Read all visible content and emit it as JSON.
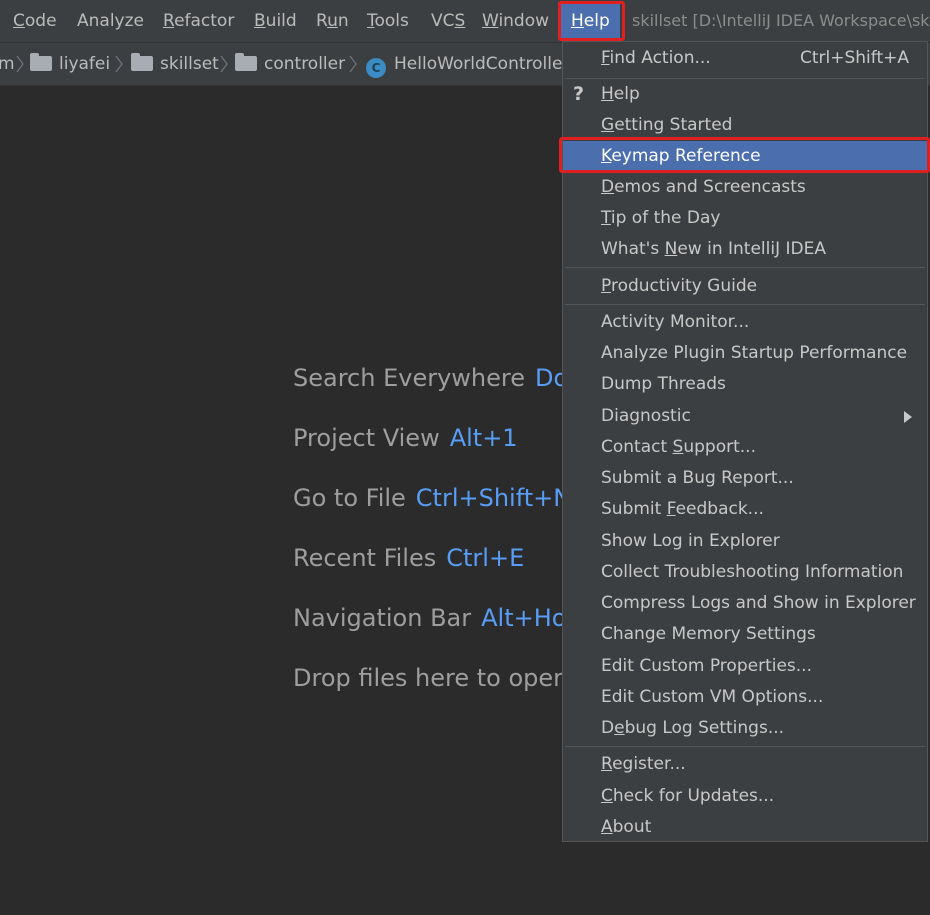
{
  "menubar": {
    "items": [
      {
        "label": "Code",
        "mn": 0
      },
      {
        "label": "Analyze",
        "mn": -1
      },
      {
        "label": "Refactor",
        "mn": 0
      },
      {
        "label": "Build",
        "mn": 0
      },
      {
        "label": "Run",
        "mn": 1
      },
      {
        "label": "Tools",
        "mn": 0
      },
      {
        "label": "VCS",
        "mn": 2
      },
      {
        "label": "Window",
        "mn": 0
      },
      {
        "label": "Help",
        "mn": 0
      }
    ],
    "window_title": "skillset [D:\\IntelliJ IDEA Workspace\\sk"
  },
  "breadcrumb": {
    "items": [
      "m",
      "liyafei",
      "skillset",
      "controller",
      "HelloWorldControlle"
    ],
    "class_icon_letter": "C"
  },
  "hints": [
    {
      "label": "Search Everywhere",
      "key": "Do"
    },
    {
      "label": "Project View",
      "key": "Alt+1"
    },
    {
      "label": "Go to File",
      "key": "Ctrl+Shift+N"
    },
    {
      "label": "Recent Files",
      "key": "Ctrl+E"
    },
    {
      "label": "Navigation Bar",
      "key": "Alt+Ho"
    },
    {
      "label": "Drop files here to oper",
      "key": ""
    }
  ],
  "help_menu": {
    "items": [
      {
        "label": "Find Action...",
        "shortcut": "Ctrl+Shift+A",
        "mn": 0
      },
      {
        "label": "Help",
        "mn": 0,
        "icon": "question-mark-icon"
      },
      {
        "label": "Getting Started",
        "mn": 0
      },
      {
        "label": "Keymap Reference",
        "mn": 0,
        "selected": true
      },
      {
        "label": "Demos and Screencasts",
        "mn": 0
      },
      {
        "label": "Tip of the Day",
        "mn": 0
      },
      {
        "label": "What's New in IntelliJ IDEA",
        "mn": 7
      },
      {
        "label": "Productivity Guide",
        "mn": 0
      },
      {
        "label": "Activity Monitor...",
        "mn": -1
      },
      {
        "label": "Analyze Plugin Startup Performance",
        "mn": -1
      },
      {
        "label": "Dump Threads",
        "mn": -1
      },
      {
        "label": "Diagnostic",
        "mn": -1,
        "submenu": true
      },
      {
        "label": "Contact Support...",
        "mn": 8
      },
      {
        "label": "Submit a Bug Report...",
        "mn": -1
      },
      {
        "label": "Submit Feedback...",
        "mn": 7
      },
      {
        "label": "Show Log in Explorer",
        "mn": -1
      },
      {
        "label": "Collect Troubleshooting Information",
        "mn": -1
      },
      {
        "label": "Compress Logs and Show in Explorer",
        "mn": -1
      },
      {
        "label": "Change Memory Settings",
        "mn": -1
      },
      {
        "label": "Edit Custom Properties...",
        "mn": -1
      },
      {
        "label": "Edit Custom VM Options...",
        "mn": -1
      },
      {
        "label": "Debug Log Settings...",
        "mn": 1
      },
      {
        "label": "Register...",
        "mn": 0
      },
      {
        "label": "Check for Updates...",
        "mn": 0
      },
      {
        "label": "About",
        "mn": 0
      }
    ]
  },
  "colors": {
    "accent": "#4b6eaf",
    "highlight_border": "#e02020",
    "shortcut": "#589df6"
  }
}
